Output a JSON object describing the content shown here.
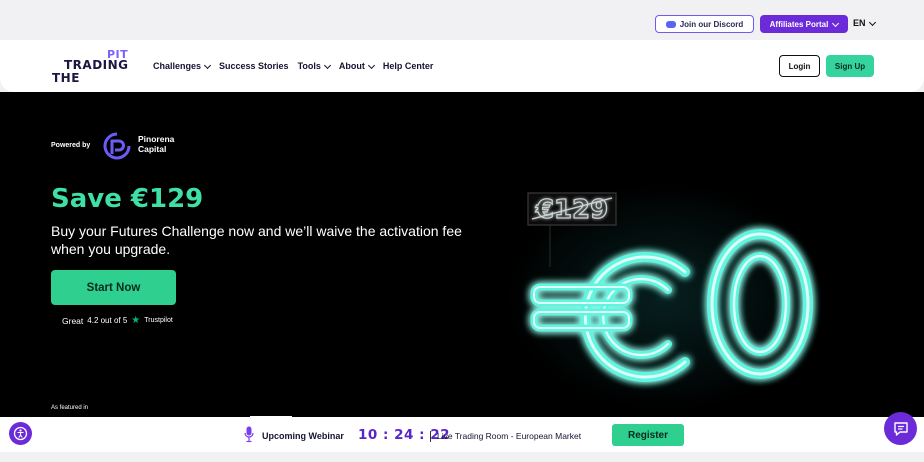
{
  "topbar": {
    "discord_label": "Join our Discord",
    "affiliates_label": "Affiliates Portal",
    "language": "EN"
  },
  "nav": {
    "logo": {
      "pit": "PIT",
      "trading": "TRADING",
      "the": "THE"
    },
    "links": [
      "Challenges",
      "Success Stories",
      "Tools",
      "About",
      "Help Center"
    ],
    "login_label": "Login",
    "signup_label": "Sign Up"
  },
  "hero": {
    "powered_by": "Powered by",
    "partner_line1": "Pinorena",
    "partner_line2": "Capital",
    "headline": "Save €129",
    "description": "Buy your Futures Challenge now and we’ll waive the activation fee when you upgrade.",
    "cta_label": "Start Now",
    "trust_great": "Great",
    "trust_rating": "4.2 out of 5",
    "trust_brand": "Trustpilot",
    "featured_label": "As featured in",
    "neon_old_price": "€129",
    "neon_new_price": "€0"
  },
  "bottom": {
    "webinar_label": "Upcoming Webinar",
    "timer": {
      "h": "10",
      "m": "24",
      "s": "22"
    },
    "live_text": "Live Trading Room - European Market",
    "register_label": "Register"
  },
  "colors": {
    "accent_green": "#3fe0a5",
    "brand_purple": "#6b2bd9",
    "neon_cyan": "#5ff5e0"
  },
  "icons": [
    "discord-icon",
    "chevron-down-icon",
    "pinorena-logo-icon",
    "trustpilot-star-icon",
    "accessibility-icon",
    "microphone-icon",
    "chat-icon"
  ]
}
